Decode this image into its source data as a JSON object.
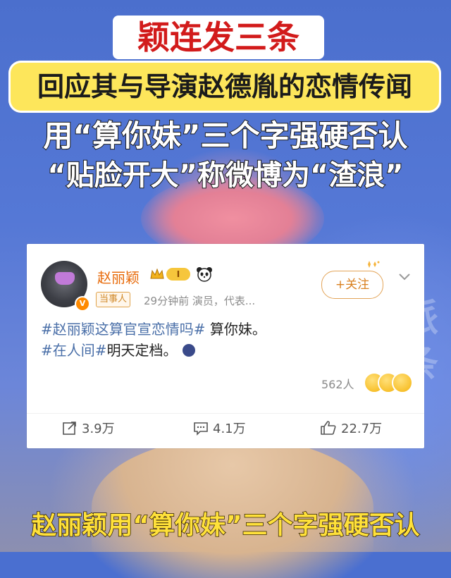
{
  "captions": {
    "top": "颖连发三条",
    "banner": "回应其与导演赵德胤的恋情传闻",
    "line2": "用“算你妹”三个字强硬否认",
    "line3": "“贴脸开大”称微博为“渣浪”",
    "bottom": "赵丽颖用“算你妹”三个字强硬否认"
  },
  "background_glyphs": "派条",
  "post": {
    "username": "赵丽颖",
    "level": "I",
    "tag": "当事人",
    "meta": "29分钟前  演员，代表...",
    "follow_label": "+关注",
    "line1_topic": "#赵丽颖这算官宣恋情吗#",
    "line1_text": " 算你妹。",
    "line2_topic": "#在人间#",
    "line2_text": "明天定档。",
    "reactions_count": "562人",
    "actions": {
      "share": "3.9万",
      "comment": "4.1万",
      "like": "22.7万"
    }
  },
  "colors": {
    "username": "#e86b0b",
    "topic": "#4a6fa8",
    "banner_bg": "#fde65b",
    "bottom_caption": "#ffe13a"
  }
}
